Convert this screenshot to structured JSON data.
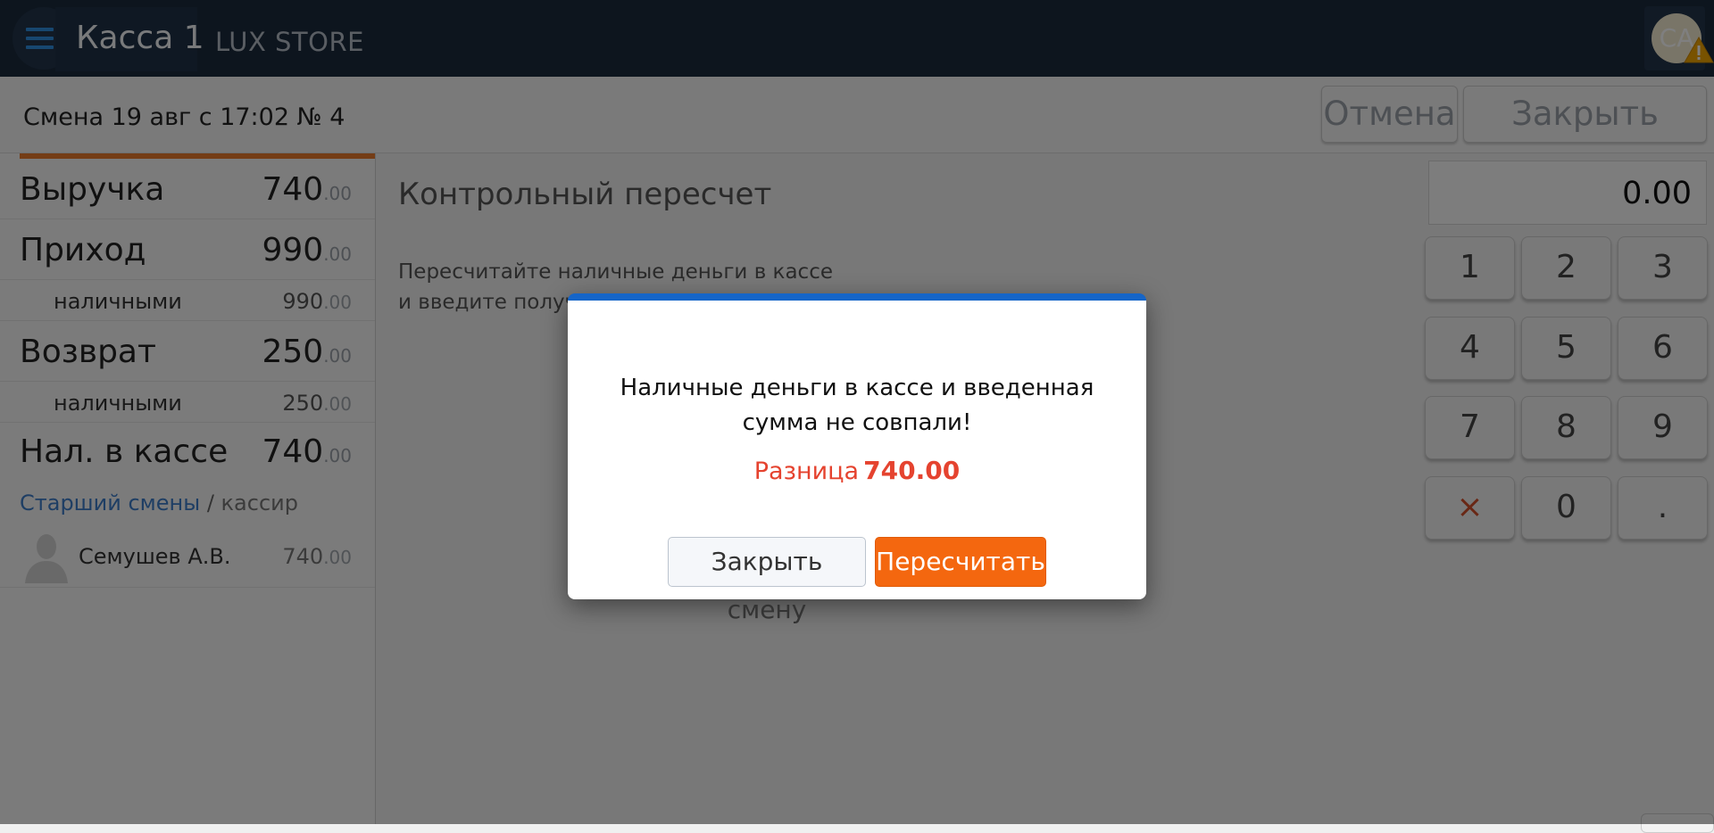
{
  "header": {
    "title": "Касса 1",
    "store": "LUX STORE",
    "avatar_initials": "CA",
    "icons": {
      "menu": "hamburger-icon",
      "warning": "warning-icon"
    }
  },
  "shift": {
    "text": "Смена 19 авг с 17:02 № 4",
    "cancel_label": "Отмена",
    "close_shift_label": "Закрыть смену"
  },
  "summary": {
    "revenue": {
      "label": "Выручка",
      "int": "740",
      "dec": ".00"
    },
    "income": {
      "label": "Приход",
      "int": "990",
      "dec": ".00"
    },
    "income_cash": {
      "label": "наличными",
      "int": "990",
      "dec": ".00"
    },
    "refund": {
      "label": "Возврат",
      "int": "250",
      "dec": ".00"
    },
    "refund_cash": {
      "label": "наличными",
      "int": "250",
      "dec": ".00"
    },
    "cash_in_till": {
      "label": "Нал. в кассе",
      "int": "740",
      "dec": ".00"
    },
    "role": {
      "senior": "Старший смены",
      "separator": "/",
      "cashier": "кассир"
    },
    "cashier": {
      "name": "Семушев А.В.",
      "int": "740",
      "dec": ".00"
    }
  },
  "recount": {
    "title": "Контрольный пересчет",
    "hint_line1": "Пересчитайте наличные деньги в кассе",
    "hint_line2": "и введите получ"
  },
  "keypad": {
    "display": "0.00",
    "keys": [
      "1",
      "2",
      "3",
      "4",
      "5",
      "6",
      "7",
      "8",
      "9",
      "×",
      "0",
      "."
    ]
  },
  "modal": {
    "message_line1": "Наличные деньги в кассе и введенная",
    "message_line2": "сумма не совпали!",
    "difference_label": "Разница",
    "difference_value": "740.00",
    "close_shift_label": "Закрыть смену",
    "recount_label": "Пересчитать",
    "accent_color": "#1565c8",
    "primary_color": "#f4670f",
    "alert_color": "#e5432f"
  }
}
